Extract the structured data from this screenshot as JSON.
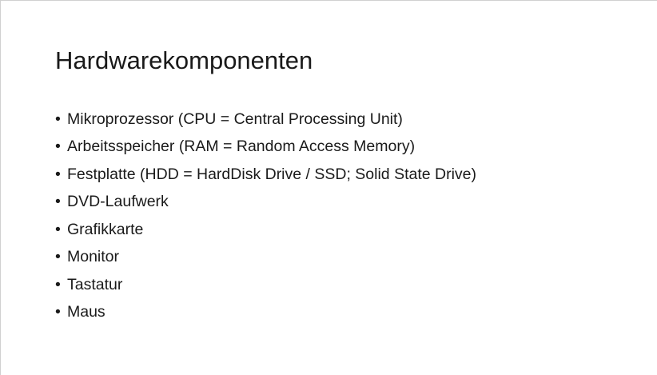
{
  "slide": {
    "title": "Hardwarekomponenten",
    "bullet_glyph": "•",
    "items": [
      {
        "label": "Mikroprozessor (CPU = Central Processing Unit)"
      },
      {
        "label": "Arbeitsspeicher (RAM = Random Access Memory)"
      },
      {
        "label": "Festplatte (HDD = HardDisk Drive / SSD; Solid State Drive)"
      },
      {
        "label": "DVD-Laufwerk"
      },
      {
        "label": "Grafikkarte"
      },
      {
        "label": "Monitor"
      },
      {
        "label": "Tastatur"
      },
      {
        "label": "Maus"
      }
    ]
  }
}
